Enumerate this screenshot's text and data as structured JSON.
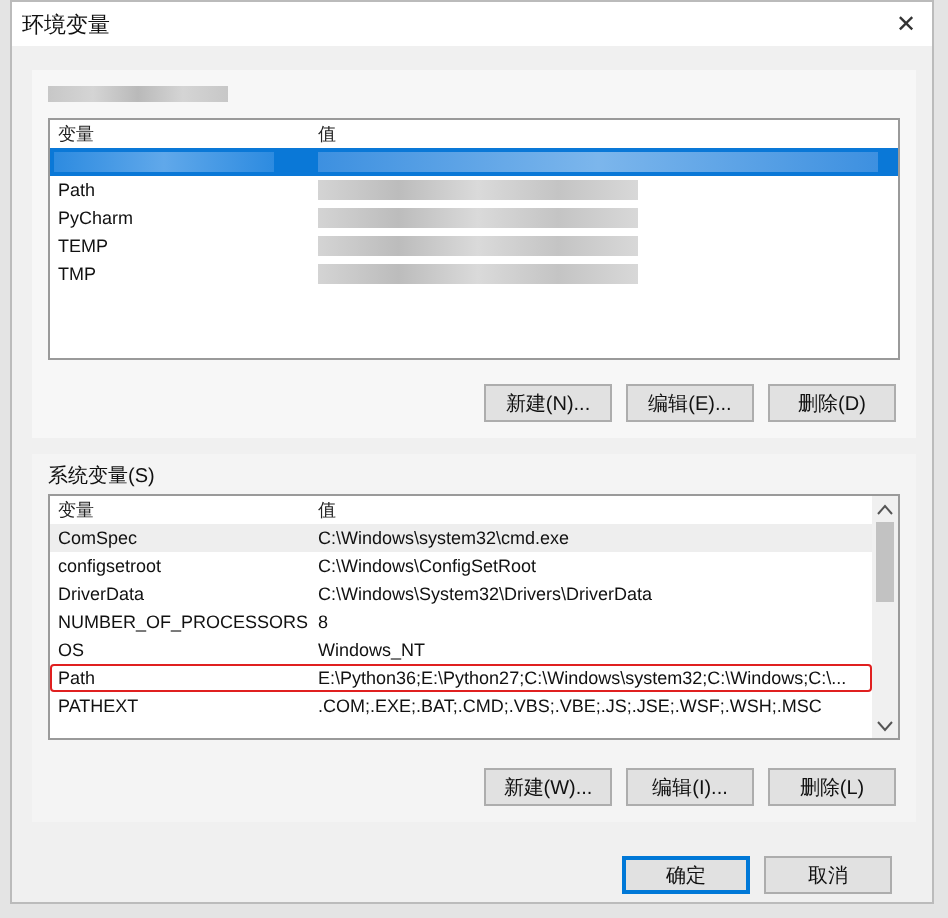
{
  "window": {
    "title": "环境变量",
    "close": "✕"
  },
  "user_variables": {
    "columns": [
      "变量",
      "值"
    ],
    "rows": [
      {
        "selected": true
      },
      {
        "name": "Path",
        "selected": false
      },
      {
        "name": "PyCharm",
        "selected": false
      },
      {
        "name": "TEMP",
        "selected": false
      },
      {
        "name": "TMP",
        "selected": false
      }
    ],
    "buttons": [
      "新建(N)...",
      "编辑(E)...",
      "删除(D)"
    ]
  },
  "system_variables": {
    "label": "系统变量(S)",
    "columns": [
      "变量",
      "值"
    ],
    "rows": [
      {
        "name": "ComSpec",
        "value": "C:\\Windows\\system32\\cmd.exe",
        "highlighted": false
      },
      {
        "name": "configsetroot",
        "value": "C:\\Windows\\ConfigSetRoot",
        "highlighted": false
      },
      {
        "name": "DriverData",
        "value": "C:\\Windows\\System32\\Drivers\\DriverData",
        "highlighted": false
      },
      {
        "name": "NUMBER_OF_PROCESSORS",
        "value": "8",
        "highlighted": false
      },
      {
        "name": "OS",
        "value": "Windows_NT",
        "highlighted": false
      },
      {
        "name": "Path",
        "value": "E:\\Python36;E:\\Python27;C:\\Windows\\system32;C:\\Windows;C:\\...",
        "highlighted": true
      },
      {
        "name": "PATHEXT",
        "value": ".COM;.EXE;.BAT;.CMD;.VBS;.VBE;.JS;.JSE;.WSF;.WSH;.MSC",
        "highlighted": false
      }
    ],
    "buttons": [
      "新建(W)...",
      "编辑(I)...",
      "删除(L)"
    ]
  },
  "footer_buttons": [
    {
      "label": "确定",
      "default": true
    },
    {
      "label": "取消",
      "default": false
    }
  ]
}
